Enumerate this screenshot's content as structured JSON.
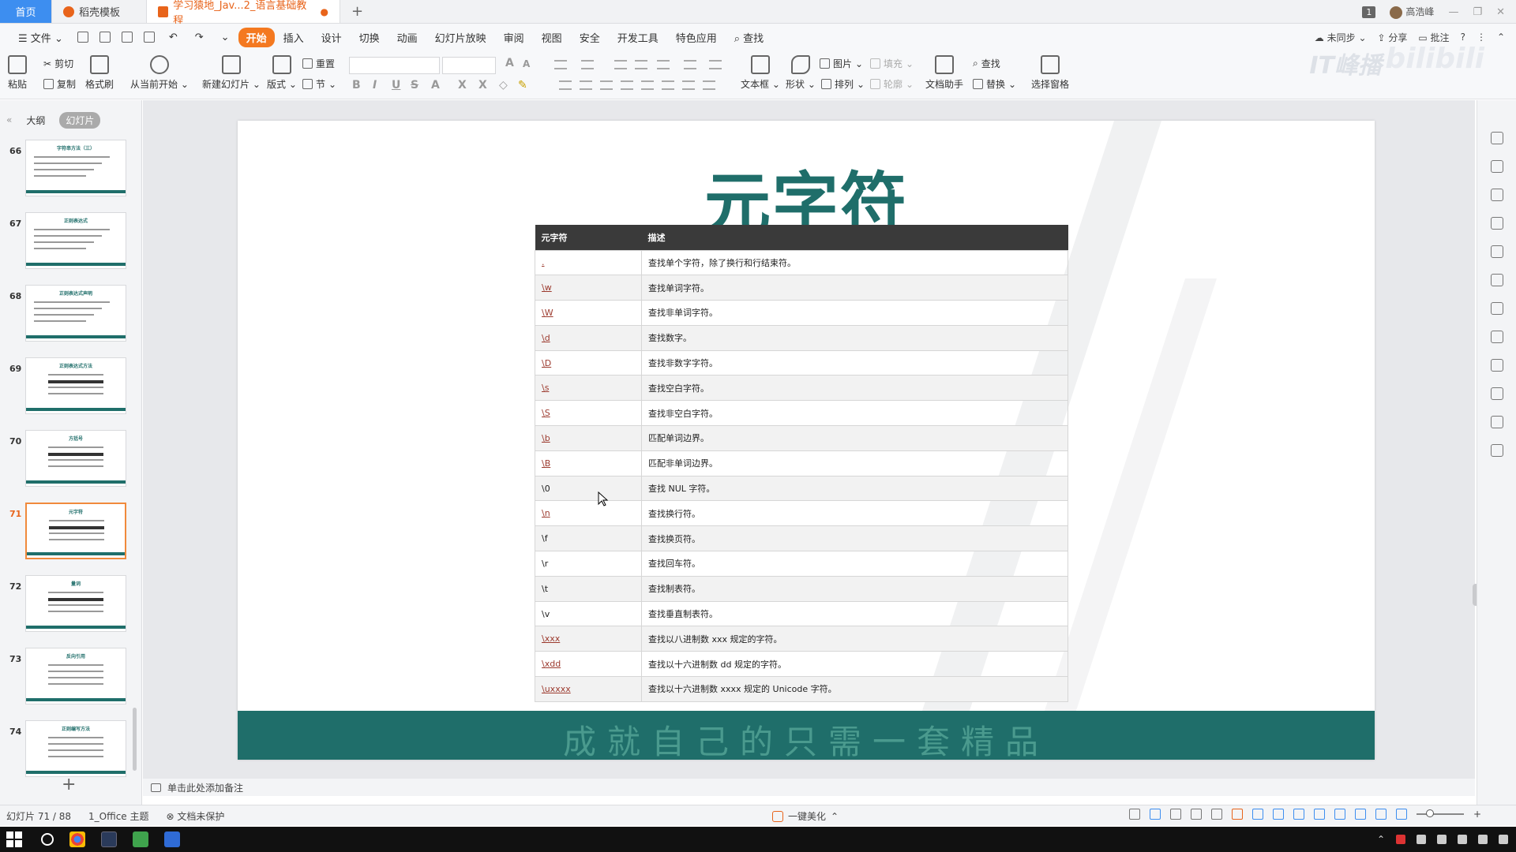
{
  "tabs": {
    "home": "首页",
    "template": "稻壳模板",
    "doc": "学习猿地_Jav...2_语言基础教程"
  },
  "window": {
    "badge": "1",
    "user": "高浩峰"
  },
  "menu": {
    "file": "文件",
    "items": [
      "开始",
      "插入",
      "设计",
      "切换",
      "动画",
      "幻灯片放映",
      "审阅",
      "视图",
      "安全",
      "开发工具",
      "特色应用"
    ],
    "search": "查找",
    "sync": "未同步",
    "share": "分享",
    "comment": "批注"
  },
  "ribbon": {
    "paste": "粘贴",
    "cut": "剪切",
    "copy": "复制",
    "format_painter": "格式刷",
    "play_from_current": "从当前开始",
    "new_slide": "新建幻灯片",
    "layout": "版式",
    "reset": "重置",
    "section": "节",
    "textbox": "文本框",
    "shape": "形状",
    "picture": "图片",
    "fill": "填充",
    "arrange": "排列",
    "outline": "轮廓",
    "doc_assistant": "文档助手",
    "find": "查找",
    "replace": "替换",
    "select_pane": "选择窗格"
  },
  "watermark": {
    "left": "IT峰播",
    "right": "bilibili"
  },
  "panel": {
    "outline_tab": "大纲",
    "slides_tab": "幻灯片",
    "thumbnails": [
      {
        "num": "66",
        "title": "字符串方法（三）"
      },
      {
        "num": "67",
        "title": "正则表达式"
      },
      {
        "num": "68",
        "title": "正则表达式声明"
      },
      {
        "num": "69",
        "title": "正则表达式方法"
      },
      {
        "num": "70",
        "title": "方括号"
      },
      {
        "num": "71",
        "title": "元字符"
      },
      {
        "num": "72",
        "title": "量词"
      },
      {
        "num": "73",
        "title": "反向引用"
      },
      {
        "num": "74",
        "title": "正则编写方法"
      }
    ],
    "add": "+"
  },
  "slide": {
    "title": "元字符",
    "footer": "成就自己的只需一套精品",
    "table": {
      "headers": [
        "元字符",
        "描述"
      ],
      "rows": [
        {
          "sym": ".",
          "desc": "查找单个字符，除了换行和行结束符。",
          "link": true
        },
        {
          "sym": "\\w",
          "desc": "查找单词字符。",
          "link": true
        },
        {
          "sym": "\\W",
          "desc": "查找非单词字符。",
          "link": true
        },
        {
          "sym": "\\d",
          "desc": "查找数字。",
          "link": true
        },
        {
          "sym": "\\D",
          "desc": "查找非数字字符。",
          "link": true
        },
        {
          "sym": "\\s",
          "desc": "查找空白字符。",
          "link": true
        },
        {
          "sym": "\\S",
          "desc": "查找非空白字符。",
          "link": true
        },
        {
          "sym": "\\b",
          "desc": "匹配单词边界。",
          "link": true
        },
        {
          "sym": "\\B",
          "desc": "匹配非单词边界。",
          "link": true
        },
        {
          "sym": "\\0",
          "desc": "查找 NUL 字符。",
          "link": false
        },
        {
          "sym": "\\n",
          "desc": "查找换行符。",
          "link": true
        },
        {
          "sym": "\\f",
          "desc": "查找换页符。",
          "link": false
        },
        {
          "sym": "\\r",
          "desc": "查找回车符。",
          "link": false
        },
        {
          "sym": "\\t",
          "desc": "查找制表符。",
          "link": false
        },
        {
          "sym": "\\v",
          "desc": "查找垂直制表符。",
          "link": false
        },
        {
          "sym": "\\xxx",
          "desc": "查找以八进制数 xxx 规定的字符。",
          "link": true
        },
        {
          "sym": "\\xdd",
          "desc": "查找以十六进制数 dd 规定的字符。",
          "link": true
        },
        {
          "sym": "\\uxxxx",
          "desc": "查找以十六进制数 xxxx 规定的 Unicode 字符。",
          "link": true
        }
      ]
    }
  },
  "notes": {
    "placeholder": "单击此处添加备注"
  },
  "status": {
    "slide_counter": "幻灯片 71 / 88",
    "theme": "1_Office 主题",
    "protection": "文档未保护",
    "beautify": "一键美化"
  },
  "colors": {
    "accent": "#f47920",
    "teal": "#1f6e6a",
    "table_header": "#3a3a3a",
    "link": "#9c3a2e"
  }
}
